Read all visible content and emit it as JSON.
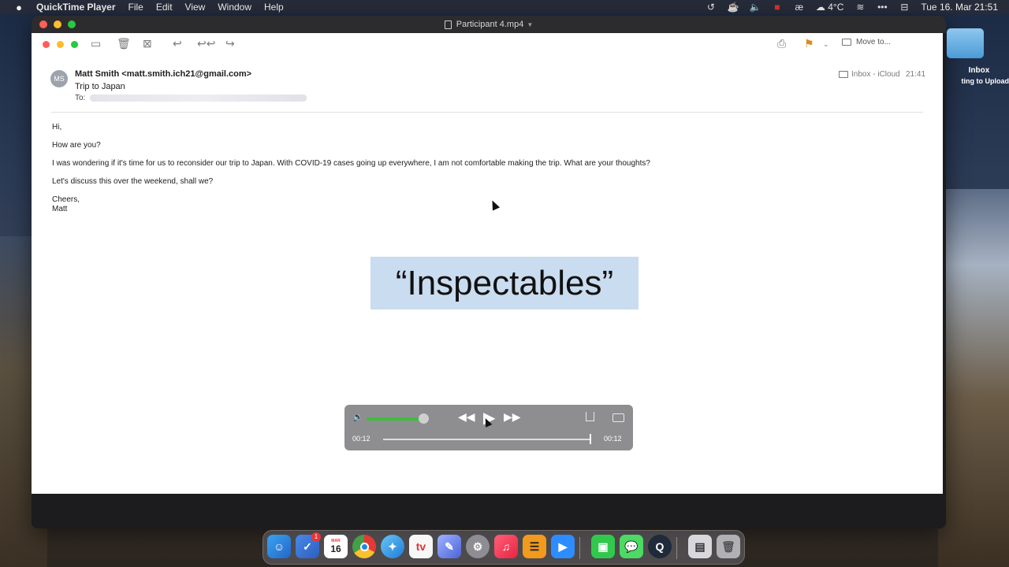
{
  "menubar": {
    "apple_icon": "apple-icon",
    "app_name": "QuickTime Player",
    "menus": [
      "File",
      "Edit",
      "View",
      "Window",
      "Help"
    ],
    "weather": "4°C",
    "datetime": "Tue 16. Mar  21:51"
  },
  "window": {
    "title": "Participant 4.mp4",
    "title_chevron": "⌄"
  },
  "mail": {
    "toolbar": {
      "move_to_label": "Move to..."
    },
    "avatar_initials": "MS",
    "from": "Matt Smith <matt.smith.ich21@gmail.com>",
    "subject": "Trip to Japan",
    "to_label": "To:",
    "mailbox": "Inbox - iCloud",
    "time": "21:41",
    "body": {
      "greeting": "Hi,",
      "line1": "How are you?",
      "line2": "I was wondering if it's time for us to reconsider our trip to Japan. With COVID-19 cases going up everywhere, I am not comfortable making the trip. What are your thoughts?",
      "line3": "Let's discuss this over the weekend, shall we?",
      "signoff": "Cheers,",
      "signature": "Matt"
    }
  },
  "caption": "“Inspectables”",
  "player": {
    "current_time": "00:12",
    "duration": "00:12",
    "volume_fraction": 0.78,
    "progress_fraction": 1.0
  },
  "desktop": {
    "folder_label": "Inbox",
    "folder_sublabel": "ting to Upload"
  },
  "dock": {
    "reminders_badge": "1",
    "calendar_day": "16",
    "calendar_month": "MAR",
    "apps": [
      "finder",
      "reminders",
      "calendar",
      "chrome",
      "safari",
      "tv",
      "feather",
      "system-preferences",
      "music",
      "keynote-like",
      "zoom",
      "facetime",
      "messages",
      "quicktime",
      "preview",
      "trash"
    ]
  },
  "colors": {
    "accent_green": "#3cbe3a",
    "flag_orange": "#e08a1e",
    "caption_bg": "#c9dcf0",
    "badge_red": "#e33333"
  }
}
